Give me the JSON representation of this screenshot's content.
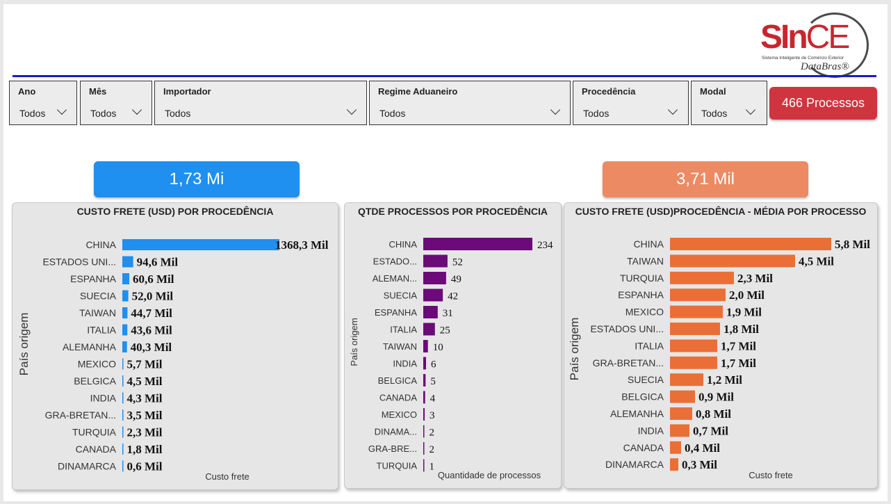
{
  "logo": {
    "brand_main": "SIn",
    "brand_ce": "CE",
    "tagline": "Sistema Inteligente de Comércio Exterior",
    "byline": "DataBras®"
  },
  "filters": [
    {
      "label": "Ano",
      "value": "Todos"
    },
    {
      "label": "Mês",
      "value": "Todos"
    },
    {
      "label": "Importador",
      "value": "Todos"
    },
    {
      "label": "Regime Aduaneiro",
      "value": "Todos"
    },
    {
      "label": "Procedência",
      "value": "Todos"
    },
    {
      "label": "Modal",
      "value": "Todos"
    }
  ],
  "process_count": "466 Processos",
  "kpis": {
    "total_freight": "1,73 Mi",
    "avg_freight": "3,71 Mil"
  },
  "colors": {
    "blue": "#1f8ff0",
    "purple": "#6b0a78",
    "orange": "#ea6f37",
    "accent_red": "#d0343f",
    "rule": "#1a1ac8"
  },
  "chart_data": [
    {
      "type": "bar",
      "orientation": "horizontal",
      "title": "CUSTO FRETE (USD) POR PROCEDÊNCIA",
      "ylabel": "País origem",
      "xlabel": "Custo frete",
      "categories": [
        "CHINA",
        "ESTADOS UNI...",
        "ESPANHA",
        "SUECIA",
        "TAIWAN",
        "ITALIA",
        "ALEMANHA",
        "MEXICO",
        "BELGICA",
        "INDIA",
        "GRA-BRETAN...",
        "TURQUIA",
        "CANADA",
        "DINAMARCA"
      ],
      "values": [
        1368.3,
        94.6,
        60.6,
        52.0,
        44.7,
        43.6,
        40.3,
        5.7,
        4.5,
        4.3,
        3.5,
        2.3,
        1.8,
        0.6
      ],
      "labels": [
        "1368,3 Mil",
        "94,6 Mil",
        "60,6 Mil",
        "52,0 Mil",
        "44,7 Mil",
        "43,6 Mil",
        "40,3 Mil",
        "5,7 Mil",
        "4,5 Mil",
        "4,3 Mil",
        "3,5 Mil",
        "2,3 Mil",
        "1,8 Mil",
        "0,6 Mil"
      ],
      "color": "#1f8ff0"
    },
    {
      "type": "bar",
      "orientation": "horizontal",
      "title": "QTDE PROCESSOS POR PROCEDÊNCIA",
      "ylabel": "País origem",
      "xlabel": "Quantidade de processos",
      "categories": [
        "CHINA",
        "ESTADO...",
        "ALEMAN...",
        "SUECIA",
        "ESPANHA",
        "ITALIA",
        "TAIWAN",
        "INDIA",
        "BELGICA",
        "CANADA",
        "MEXICO",
        "DINAMA...",
        "GRA-BRE...",
        "TURQUIA"
      ],
      "values": [
        234,
        52,
        49,
        42,
        31,
        25,
        10,
        6,
        5,
        4,
        3,
        2,
        2,
        1
      ],
      "labels": [
        "234",
        "52",
        "49",
        "42",
        "31",
        "25",
        "10",
        "6",
        "5",
        "4",
        "3",
        "2",
        "2",
        "1"
      ],
      "color": "#6b0a78"
    },
    {
      "type": "bar",
      "orientation": "horizontal",
      "title": "CUSTO FRETE (USD)PROCEDÊNCIA - MÉDIA POR PROCESSO",
      "ylabel": "País origem",
      "xlabel": "Custo frete",
      "categories": [
        "CHINA",
        "TAIWAN",
        "TURQUIA",
        "ESPANHA",
        "MEXICO",
        "ESTADOS UNI...",
        "ITALIA",
        "GRA-BRETAN...",
        "SUECIA",
        "BELGICA",
        "ALEMANHA",
        "INDIA",
        "CANADA",
        "DINAMARCA"
      ],
      "values": [
        5.8,
        4.5,
        2.3,
        2.0,
        1.9,
        1.8,
        1.7,
        1.7,
        1.2,
        0.9,
        0.8,
        0.7,
        0.4,
        0.3
      ],
      "labels": [
        "5,8 Mil",
        "4,5 Mil",
        "2,3 Mil",
        "2,0 Mil",
        "1,9 Mil",
        "1,8 Mil",
        "1,7 Mil",
        "1,7 Mil",
        "1,2 Mil",
        "0,9 Mil",
        "0,8 Mil",
        "0,7 Mil",
        "0,4 Mil",
        "0,3 Mil"
      ],
      "color": "#ea6f37"
    }
  ]
}
